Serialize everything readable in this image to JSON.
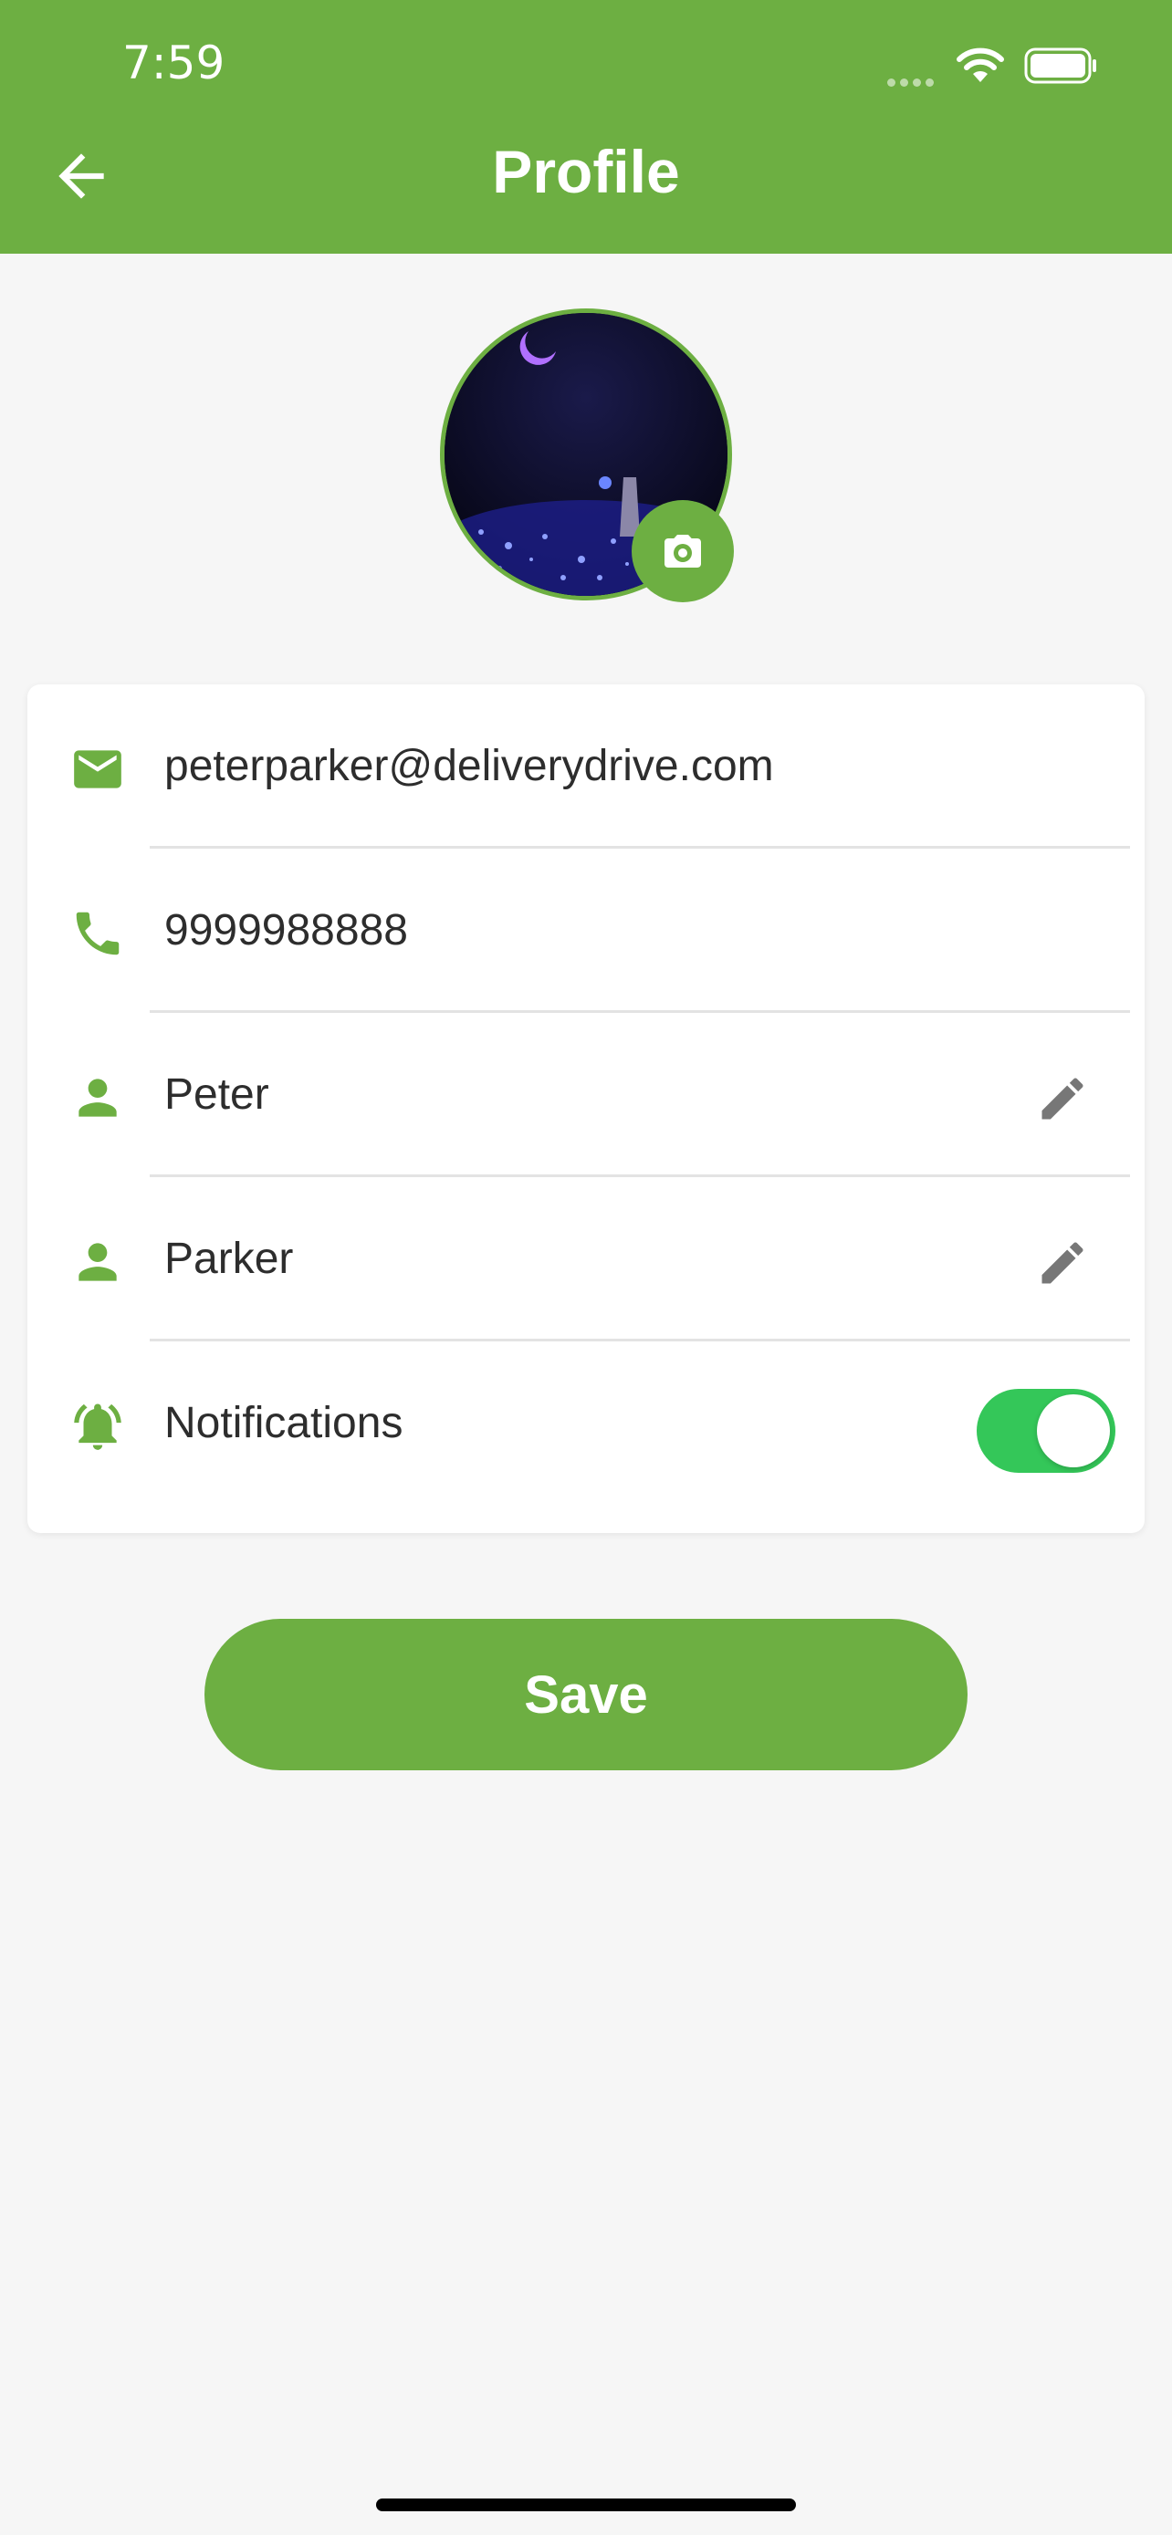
{
  "status_bar": {
    "time": "7:59"
  },
  "header": {
    "title": "Profile",
    "back_icon": "arrow-left-icon"
  },
  "profile": {
    "camera_icon": "camera-icon"
  },
  "fields": [
    {
      "icon": "email-icon",
      "value": "peterparker@deliverydrive.com",
      "editable": false
    },
    {
      "icon": "phone-icon",
      "value": "9999988888",
      "editable": false
    },
    {
      "icon": "person-icon",
      "value": "Peter",
      "editable": true
    },
    {
      "icon": "person-icon",
      "value": "Parker",
      "editable": true
    }
  ],
  "notifications": {
    "label": "Notifications",
    "enabled": true
  },
  "save_label": "Save",
  "colors": {
    "brand": "#6daf42",
    "toggle_on": "#34c759",
    "edit_icon": "#777777"
  }
}
